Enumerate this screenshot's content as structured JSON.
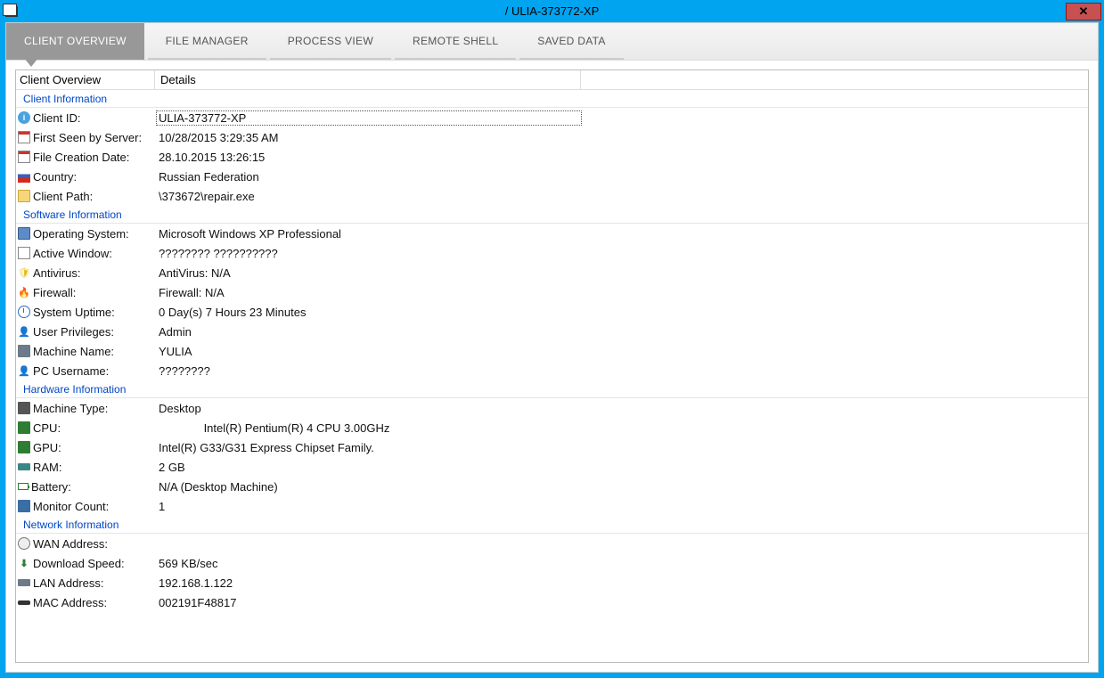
{
  "window": {
    "title": "/ ULIA-373772-XP"
  },
  "tabs": [
    {
      "label": "CLIENT OVERVIEW",
      "active": true
    },
    {
      "label": "FILE MANAGER",
      "active": false
    },
    {
      "label": "PROCESS VIEW",
      "active": false
    },
    {
      "label": "REMOTE SHELL",
      "active": false
    },
    {
      "label": "SAVED DATA",
      "active": false
    }
  ],
  "columns": {
    "col1": "Client Overview",
    "col2": "Details"
  },
  "sections": {
    "client": {
      "title": "Client Information",
      "rows": [
        {
          "icon": "ic-info",
          "glyph": "i",
          "label": "Client ID:",
          "value": "ULIA-373772-XP",
          "selected": true
        },
        {
          "icon": "ic-cal",
          "glyph": "",
          "label": "First Seen by Server:",
          "value": "10/28/2015 3:29:35 AM"
        },
        {
          "icon": "ic-cal",
          "glyph": "",
          "label": "File Creation Date:",
          "value": "28.10.2015 13:26:15"
        },
        {
          "icon": "ic-flag",
          "glyph": "",
          "label": "Country:",
          "value": "Russian Federation"
        },
        {
          "icon": "ic-folder",
          "glyph": "",
          "label": "Client Path:",
          "value": "\\373672\\repair.exe"
        }
      ]
    },
    "software": {
      "title": "Software Information",
      "rows": [
        {
          "icon": "ic-monitor",
          "glyph": "",
          "label": "Operating System:",
          "value": "Microsoft Windows XP Professional"
        },
        {
          "icon": "ic-window",
          "glyph": "",
          "label": "Active Window:",
          "value": "???????? ??????????"
        },
        {
          "icon": "ic-shield",
          "glyph": "🛡",
          "label": "Antivirus:",
          "value": "AntiVirus: N/A"
        },
        {
          "icon": "ic-fire",
          "glyph": "🔥",
          "label": "Firewall:",
          "value": "Firewall: N/A"
        },
        {
          "icon": "ic-clock",
          "glyph": "",
          "label": "System Uptime:",
          "value": "0 Day(s) 7 Hours 23 Minutes"
        },
        {
          "icon": "ic-user",
          "glyph": "👤",
          "label": "User Privileges:",
          "value": "Admin"
        },
        {
          "icon": "ic-machine",
          "glyph": "",
          "label": "Machine Name:",
          "value": "YULIA"
        },
        {
          "icon": "ic-pc",
          "glyph": "👤",
          "label": "PC Username:",
          "value": "????????"
        }
      ]
    },
    "hardware": {
      "title": "Hardware Information",
      "rows": [
        {
          "icon": "ic-desktop",
          "glyph": "",
          "label": "Machine Type:",
          "value": "Desktop"
        },
        {
          "icon": "ic-cpu",
          "glyph": "",
          "label": "CPU:",
          "value": "              Intel(R) Pentium(R) 4 CPU 3.00GHz"
        },
        {
          "icon": "ic-gpu",
          "glyph": "",
          "label": "GPU:",
          "value": "Intel(R) G33/G31 Express Chipset Family."
        },
        {
          "icon": "ic-ram",
          "glyph": "",
          "label": "RAM:",
          "value": "2 GB"
        },
        {
          "icon": "ic-battery",
          "glyph": "",
          "label": "Battery:",
          "value": "N/A (Desktop Machine)"
        },
        {
          "icon": "ic-moncount",
          "glyph": "",
          "label": "Monitor Count:",
          "value": "1"
        }
      ]
    },
    "network": {
      "title": "Network Information",
      "rows": [
        {
          "icon": "ic-globe",
          "glyph": "",
          "label": "WAN Address:",
          "value": ""
        },
        {
          "icon": "ic-down",
          "glyph": "⬇",
          "label": "Download Speed:",
          "value": "569 KB/sec"
        },
        {
          "icon": "ic-lan",
          "glyph": "",
          "label": "LAN Address:",
          "value": "192.168.1.122"
        },
        {
          "icon": "ic-mac",
          "glyph": "",
          "label": "MAC Address:",
          "value": "002191F48817"
        }
      ]
    }
  }
}
